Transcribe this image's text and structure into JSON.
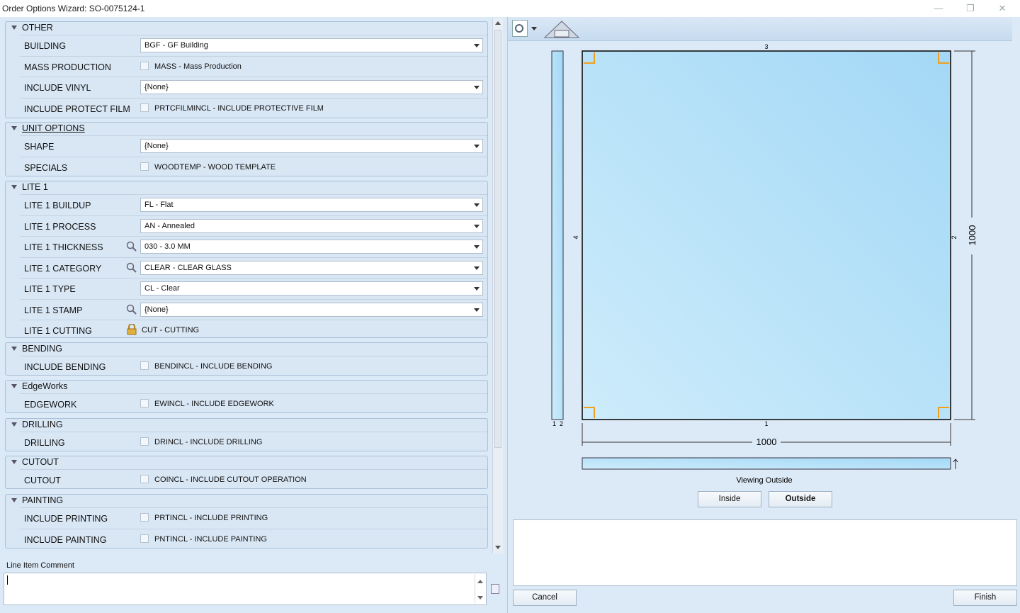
{
  "window": {
    "title": "Order Options Wizard: SO-0075124-1"
  },
  "groups": [
    {
      "title": "OTHER",
      "rows": [
        {
          "label": "BUILDING",
          "kind": "combo",
          "value": "BGF - GF Building"
        },
        {
          "label": "MASS PRODUCTION",
          "kind": "check",
          "value": "MASS - Mass Production"
        },
        {
          "label": "INCLUDE VINYL",
          "kind": "combo",
          "value": "{None}"
        },
        {
          "label": "INCLUDE PROTECT FILM",
          "kind": "check",
          "value": "PRTCFILMINCL - INCLUDE PROTECTIVE FILM"
        }
      ]
    },
    {
      "title": "UNIT OPTIONS",
      "rows": [
        {
          "label": "SHAPE",
          "kind": "combo",
          "value": "{None}"
        },
        {
          "label": "SPECIALS",
          "kind": "check",
          "value": "WOODTEMP - WOOD TEMPLATE"
        }
      ]
    },
    {
      "title": "LITE 1",
      "rows": [
        {
          "label": "LITE 1 BUILDUP",
          "kind": "combo",
          "value": "FL - Flat"
        },
        {
          "label": "LITE 1 PROCESS",
          "kind": "combo",
          "value": "AN - Annealed"
        },
        {
          "label": "LITE 1 THICKNESS",
          "kind": "combo",
          "value": "030 - 3.0 MM",
          "search": true
        },
        {
          "label": "LITE 1 CATEGORY",
          "kind": "combo",
          "value": "CLEAR - CLEAR GLASS",
          "search": true
        },
        {
          "label": "LITE 1 TYPE",
          "kind": "combo",
          "value": "CL - Clear"
        },
        {
          "label": "LITE 1 STAMP",
          "kind": "combo",
          "value": "{None}",
          "search": true
        },
        {
          "label": "LITE 1 CUTTING",
          "kind": "locked",
          "value": "CUT - CUTTING"
        }
      ]
    },
    {
      "title": "BENDING",
      "rows": [
        {
          "label": "INCLUDE BENDING",
          "kind": "check",
          "value": "BENDINCL - INCLUDE BENDING"
        }
      ]
    },
    {
      "title": "EdgeWorks",
      "rows": [
        {
          "label": "EDGEWORK",
          "kind": "check",
          "value": "EWINCL - INCLUDE EDGEWORK"
        }
      ]
    },
    {
      "title": "DRILLING",
      "rows": [
        {
          "label": "DRILLING",
          "kind": "check",
          "value": "DRINCL - INCLUDE DRILLING"
        }
      ]
    },
    {
      "title": "CUTOUT",
      "rows": [
        {
          "label": "CUTOUT",
          "kind": "check",
          "value": "COINCL - INCLUDE CUTOUT OPERATION"
        }
      ]
    },
    {
      "title": "PAINTING",
      "rows": [
        {
          "label": "INCLUDE PRINTING",
          "kind": "check",
          "value": "PRTINCL - INCLUDE PRINTING"
        },
        {
          "label": "INCLUDE PAINTING",
          "kind": "check",
          "value": "PNTINCL - INCLUDE PAINTING"
        }
      ]
    }
  ],
  "comment": {
    "label": "Line Item Comment",
    "value": ""
  },
  "drawing": {
    "width": "1000",
    "height": "1000",
    "edge_top": "3",
    "edge_right": "2",
    "edge_bottom": "1",
    "edge_left": "4",
    "side_small_a": "1",
    "side_small_b": "2",
    "viewing": "Viewing Outside"
  },
  "buttons": {
    "inside": "Inside",
    "outside": "Outside",
    "cancel": "Cancel",
    "finish": "Finish"
  },
  "colors": {
    "glass": "#b4e0f8",
    "corner": "#f0a020"
  }
}
